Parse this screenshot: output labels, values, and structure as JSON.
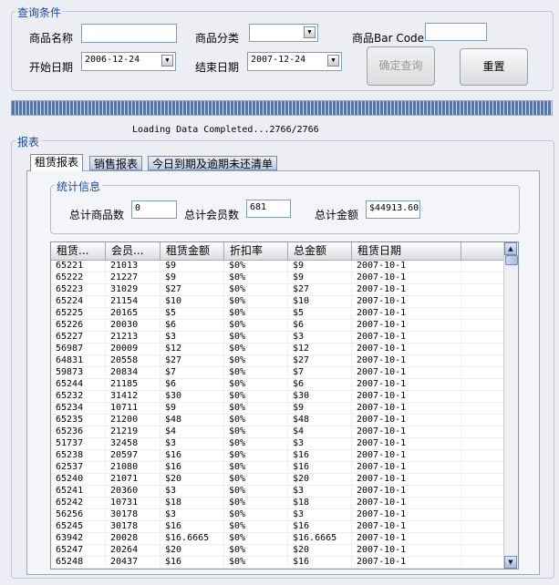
{
  "query": {
    "legend": "查询条件",
    "name_label": "商品名称",
    "name_value": "",
    "category_label": "商品分类",
    "category_value": "",
    "barcode_label": "商品Bar Code",
    "barcode_value": "",
    "start_label": "开始日期",
    "start_value": "2006-12-24",
    "end_label": "结束日期",
    "end_value": "2007-12-24",
    "confirm_label": "确定查询",
    "reset_label": "重置"
  },
  "progress": {
    "percent": 100
  },
  "status": "Loading Data Completed...2766/2766",
  "report": {
    "legend": "报表",
    "tabs": [
      "租赁报表",
      "销售报表",
      "今日到期及逾期未还清单"
    ],
    "stats": {
      "legend": "统计信息",
      "items_label": "总计商品数",
      "items_value": "0",
      "members_label": "总计会员数",
      "members_value": "681",
      "amount_label": "总计金额",
      "amount_value": "$44913.60"
    },
    "columns": [
      "租赁...",
      "会员...",
      "租赁金额",
      "折扣率",
      "总金额",
      "租赁日期",
      ""
    ],
    "rows": [
      [
        "65221",
        "21013",
        "$9",
        "$0%",
        "$9",
        "2007-10-1"
      ],
      [
        "65222",
        "21227",
        "$9",
        "$0%",
        "$9",
        "2007-10-1"
      ],
      [
        "65223",
        "31029",
        "$27",
        "$0%",
        "$27",
        "2007-10-1"
      ],
      [
        "65224",
        "21154",
        "$10",
        "$0%",
        "$10",
        "2007-10-1"
      ],
      [
        "65225",
        "20165",
        "$5",
        "$0%",
        "$5",
        "2007-10-1"
      ],
      [
        "65226",
        "20030",
        "$6",
        "$0%",
        "$6",
        "2007-10-1"
      ],
      [
        "65227",
        "21213",
        "$3",
        "$0%",
        "$3",
        "2007-10-1"
      ],
      [
        "56987",
        "20009",
        "$12",
        "$0%",
        "$12",
        "2007-10-1"
      ],
      [
        "64831",
        "20558",
        "$27",
        "$0%",
        "$27",
        "2007-10-1"
      ],
      [
        "59873",
        "20834",
        "$7",
        "$0%",
        "$7",
        "2007-10-1"
      ],
      [
        "65244",
        "21185",
        "$6",
        "$0%",
        "$6",
        "2007-10-1"
      ],
      [
        "65232",
        "31412",
        "$30",
        "$0%",
        "$30",
        "2007-10-1"
      ],
      [
        "65234",
        "10711",
        "$9",
        "$0%",
        "$9",
        "2007-10-1"
      ],
      [
        "65235",
        "21200",
        "$48",
        "$0%",
        "$48",
        "2007-10-1"
      ],
      [
        "65236",
        "21219",
        "$4",
        "$0%",
        "$4",
        "2007-10-1"
      ],
      [
        "51737",
        "32458",
        "$3",
        "$0%",
        "$3",
        "2007-10-1"
      ],
      [
        "65238",
        "20597",
        "$16",
        "$0%",
        "$16",
        "2007-10-1"
      ],
      [
        "62537",
        "21080",
        "$16",
        "$0%",
        "$16",
        "2007-10-1"
      ],
      [
        "65240",
        "21071",
        "$20",
        "$0%",
        "$20",
        "2007-10-1"
      ],
      [
        "65241",
        "20360",
        "$3",
        "$0%",
        "$3",
        "2007-10-1"
      ],
      [
        "65242",
        "10731",
        "$18",
        "$0%",
        "$18",
        "2007-10-1"
      ],
      [
        "56256",
        "30178",
        "$3",
        "$0%",
        "$3",
        "2007-10-1"
      ],
      [
        "65245",
        "30178",
        "$16",
        "$0%",
        "$16",
        "2007-10-1"
      ],
      [
        "63942",
        "20028",
        "$16.6665",
        "$0%",
        "$16.6665",
        "2007-10-1"
      ],
      [
        "65247",
        "20264",
        "$20",
        "$0%",
        "$20",
        "2007-10-1"
      ],
      [
        "65248",
        "20437",
        "$16",
        "$0%",
        "$16",
        "2007-10-1"
      ]
    ]
  }
}
